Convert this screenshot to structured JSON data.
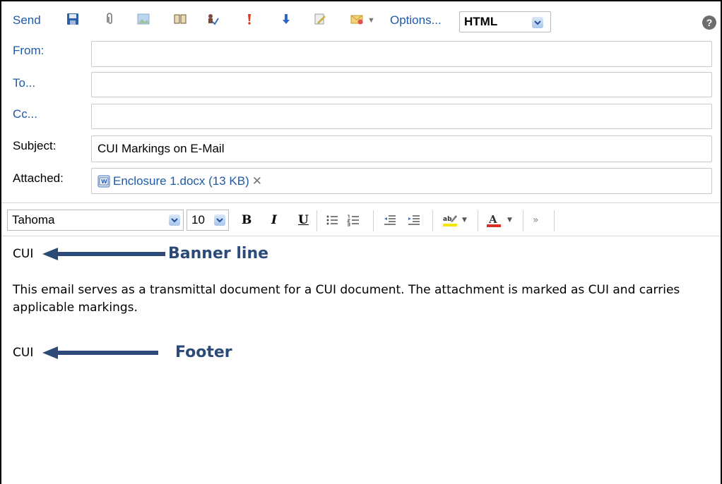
{
  "toolbar": {
    "send_label": "Send",
    "icons": [
      "save-icon",
      "paperclip-icon",
      "image-icon",
      "address-book-icon",
      "check-names-icon",
      "high-importance-icon",
      "low-importance-icon",
      "signature-icon",
      "follow-up-flag-icon"
    ],
    "options_label": "Options...",
    "format_value": "HTML",
    "help_glyph": "?"
  },
  "header": {
    "from_label": "From:",
    "from_value": "",
    "to_label": "To...",
    "to_value": "",
    "cc_label": "Cc...",
    "cc_value": "",
    "subject_label": "Subject:",
    "subject_value": "CUI Markings on E-Mail",
    "attached_label": "Attached:",
    "attachment_name": "Enclosure 1.docx (13 KB)"
  },
  "format_bar": {
    "font_value": "Tahoma",
    "size_value": "10",
    "bold": "B",
    "italic": "I",
    "underline": "U"
  },
  "body": {
    "banner_text": "CUI",
    "paragraph": "This email serves as a transmittal document for a CUI document.  The attachment is marked as CUI and carries applicable markings.",
    "footer_text": "CUI"
  },
  "annotations": {
    "banner_label": "Banner line",
    "footer_label": "Footer"
  },
  "colors": {
    "link": "#1f5aa6",
    "annotation": "#2c4a78"
  }
}
